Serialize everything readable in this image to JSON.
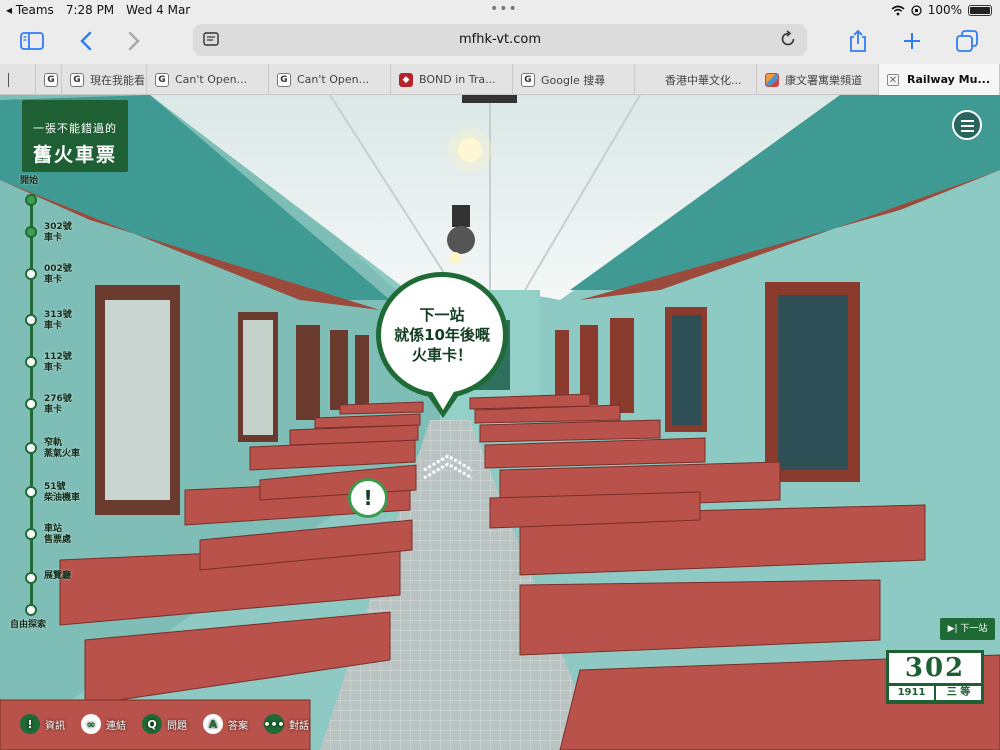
{
  "status_bar": {
    "back_app": "Teams",
    "time": "7:28 PM",
    "date": "Wed 4 Mar",
    "battery": "100%"
  },
  "browser": {
    "url": "mfhk-vt.com",
    "tabs": [
      {
        "label": "",
        "favicon": "blank"
      },
      {
        "label": "",
        "favicon": "G"
      },
      {
        "label": "現在我能看",
        "favicon": "G"
      },
      {
        "label": "Can't Open...",
        "favicon": "G"
      },
      {
        "label": "Can't Open...",
        "favicon": "G"
      },
      {
        "label": "BOND in Tra...",
        "favicon": "red"
      },
      {
        "label": "Google 搜尋",
        "favicon": "G"
      },
      {
        "label": "香港中華文化...",
        "favicon": "blank"
      },
      {
        "label": "康文署寓樂頻道",
        "favicon": "multi"
      },
      {
        "label": "Railway Mu...",
        "favicon": "close",
        "active": true
      }
    ]
  },
  "logo": {
    "line1": "一張不能錯過的",
    "line2": "舊火車票"
  },
  "timeline": [
    {
      "label": "開始",
      "done": true
    },
    {
      "label": "302號\n車卡",
      "done": true
    },
    {
      "label": "002號\n車卡",
      "done": false
    },
    {
      "label": "313號\n車卡",
      "done": false
    },
    {
      "label": "112號\n車卡",
      "done": false
    },
    {
      "label": "276號\n車卡",
      "done": false
    },
    {
      "label": "窄軌\n蒸氣火車",
      "done": false
    },
    {
      "label": "51號\n柴油機車",
      "done": false
    },
    {
      "label": "車站\n售票處",
      "done": false
    },
    {
      "label": "展覽廳",
      "done": false
    },
    {
      "label": "自由探索",
      "done": false
    }
  ],
  "bubble": {
    "line1": "下一站",
    "line2": "就係10年後嘅",
    "line3": "火車卡！"
  },
  "hotspot": {
    "label": "!"
  },
  "next_button": {
    "label": "▶| 下一站"
  },
  "ticket": {
    "number": "302",
    "year": "1911",
    "class": "三 等"
  },
  "bottom_bar": [
    {
      "icon": "!",
      "label": "資訊",
      "name": "info"
    },
    {
      "icon": "∞",
      "label": "連結",
      "name": "link"
    },
    {
      "icon": "Q",
      "label": "問題",
      "name": "question"
    },
    {
      "icon": "A",
      "label": "答案",
      "name": "answer"
    },
    {
      "icon": "•••",
      "label": "對話",
      "name": "dialogue"
    }
  ],
  "colors": {
    "brand_green": "#1f6a35",
    "safari_blue": "#2f7cf6",
    "seat_red": "#b8524a",
    "wall_teal": "#8fc9c4"
  }
}
